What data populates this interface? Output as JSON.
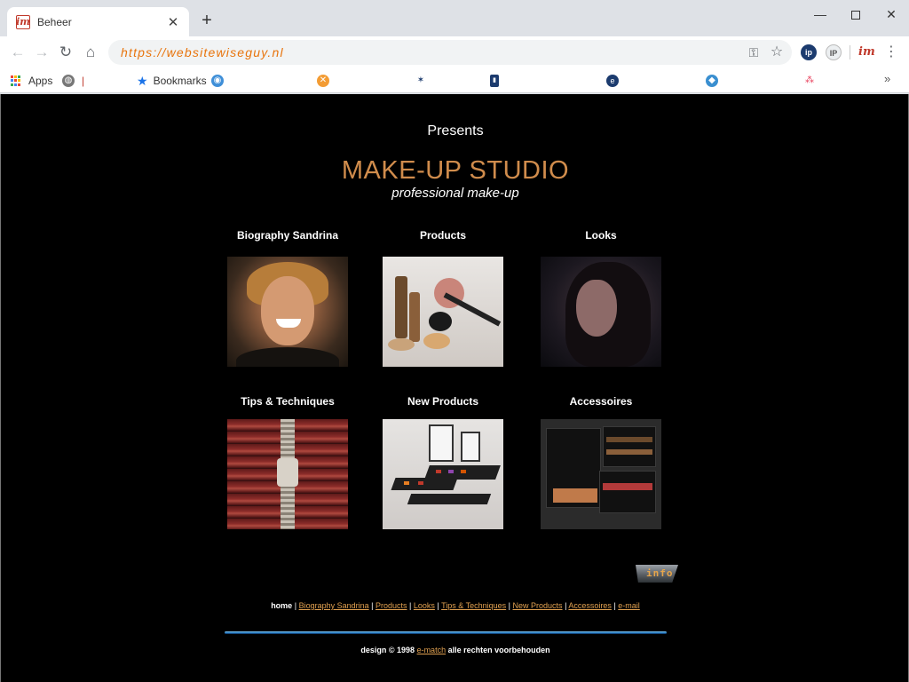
{
  "browser": {
    "tab_title": "Beheer",
    "tab_favicon_text": "im",
    "new_tab_symbol": "+",
    "url": "https://websitewiseguy.nl",
    "bookmarks": {
      "apps_label": "Apps",
      "bookmarks_label": "Bookmarks",
      "divider": "|",
      "overflow": "»"
    },
    "extensions": [
      "ip",
      "IP",
      "im"
    ],
    "apps_grid_colors": [
      "#ea4335",
      "#fbbc05",
      "#34a853",
      "#4285f4",
      "#ea4335",
      "#fbbc05",
      "#34a853",
      "#4285f4",
      "#ea4335"
    ]
  },
  "page": {
    "presents": "Presents",
    "title": "MAKE-UP STUDIO",
    "subtitle": "professional make-up",
    "tiles": [
      {
        "label": "Biography Sandrina"
      },
      {
        "label": "Products"
      },
      {
        "label": "Looks"
      },
      {
        "label": "Tips & Techniques"
      },
      {
        "label": "New Products"
      },
      {
        "label": "Accessoires"
      }
    ],
    "info_label": "info",
    "footer_nav": {
      "home": "home",
      "links": [
        "Biography Sandrina",
        "Products",
        "Looks",
        "Tips & Techniques",
        "New Products",
        "Accessoires",
        "e-mail"
      ]
    },
    "credit": {
      "prefix": "design © 1998",
      "link": "e-match",
      "suffix": "alle rechten voorbehouden"
    }
  }
}
